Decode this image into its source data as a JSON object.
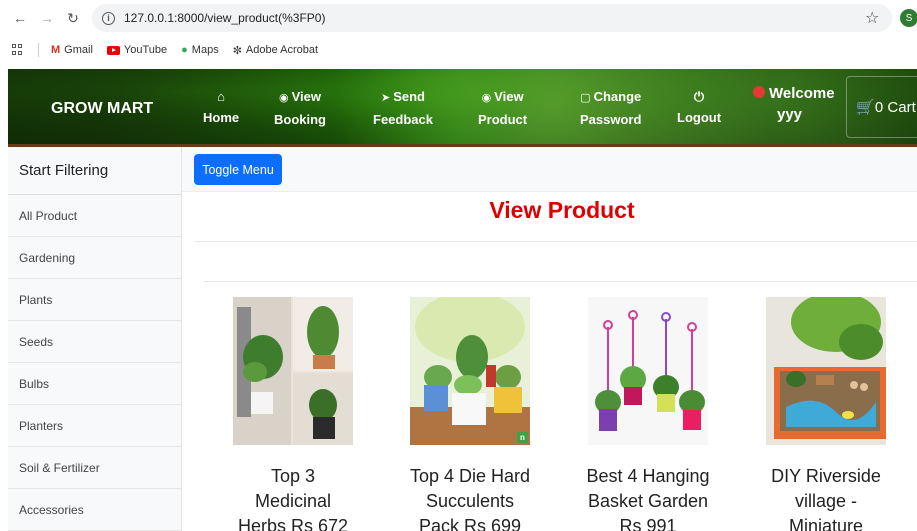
{
  "browser": {
    "url": "127.0.0.1:8000/view_product(%3FP0)",
    "profile_initial": "S",
    "bookmarks": [
      "Gmail",
      "YouTube",
      "Maps",
      "Adobe Acrobat"
    ]
  },
  "navbar": {
    "brand": "GROW MART",
    "items": [
      {
        "icon": "home-icon",
        "line1": "Home",
        "line2": ""
      },
      {
        "icon": "eye-icon",
        "line1": "View",
        "line2": "Booking"
      },
      {
        "icon": "send-icon",
        "line1": "Send",
        "line2": "Feedback"
      },
      {
        "icon": "eye-icon",
        "line1": "View",
        "line2": "Product"
      },
      {
        "icon": "document-icon",
        "line1": "Change",
        "line2": "Password"
      },
      {
        "icon": "power-icon",
        "line1": "Logout",
        "line2": ""
      }
    ],
    "welcome_line1": "Welcome",
    "welcome_line2": "yyy",
    "cart_label": "0 Cart"
  },
  "sidebar": {
    "heading": "Start Filtering",
    "items": [
      "All Product",
      "Gardening",
      "Plants",
      "Seeds",
      "Bulbs",
      "Planters",
      "Soil & Fertilizer",
      "Accessories"
    ]
  },
  "main": {
    "toggle_label": "Toggle Menu",
    "title": "View Product",
    "products": [
      {
        "line1": "Top 3",
        "line2": "Medicinal",
        "line3": "Herbs Rs 672"
      },
      {
        "line1": "Top 4 Die Hard",
        "line2": "Succulents",
        "line3": "Pack Rs 699"
      },
      {
        "line1": "Best 4 Hanging",
        "line2": "Basket Garden",
        "line3": "Rs 991"
      },
      {
        "line1": "DIY Riverside",
        "line2": "village -",
        "line3": "Miniature"
      }
    ]
  },
  "colors": {
    "title_red": "#e00000",
    "button_blue": "#0d6efd"
  }
}
